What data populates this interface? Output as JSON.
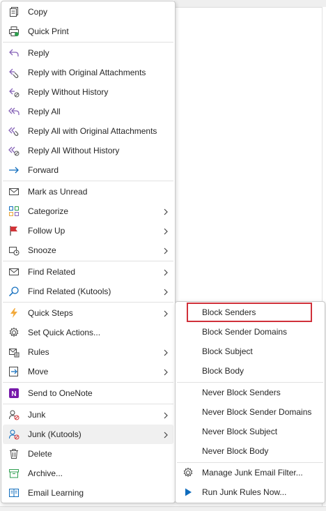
{
  "menu": {
    "items": [
      {
        "label": "Copy",
        "ul": "",
        "icon": "copy-icon"
      },
      {
        "label": "Quick Print",
        "ul": "",
        "icon": "quick-print-icon"
      },
      {
        "label": "Reply",
        "ul": "",
        "icon": "reply-icon"
      },
      {
        "label": "Reply with Original Attachments",
        "icon": "reply-attachments-icon"
      },
      {
        "label": "Reply Without History",
        "icon": "reply-no-history-icon"
      },
      {
        "label": "Reply All",
        "icon": "reply-all-icon"
      },
      {
        "label": "Reply All with Original Attachments",
        "icon": "reply-all-attachments-icon"
      },
      {
        "label": "Reply All Without History",
        "icon": "reply-all-no-history-icon"
      },
      {
        "label": "Forward",
        "icon": "forward-icon"
      },
      {
        "label": "Mark as Unread",
        "icon": "mark-unread-icon"
      },
      {
        "label": "Categorize",
        "icon": "categorize-icon"
      },
      {
        "label": "Follow Up",
        "icon": "follow-up-flag-icon"
      },
      {
        "label": "Snooze",
        "icon": "snooze-icon"
      },
      {
        "label": "Find Related",
        "icon": "find-related-icon"
      },
      {
        "label": "Find Related (Kutools)",
        "icon": "search-icon"
      },
      {
        "label": "Quick Steps",
        "icon": "lightning-icon"
      },
      {
        "label": "Set Quick Actions...",
        "icon": "gear-icon"
      },
      {
        "label": "Rules",
        "icon": "rules-icon"
      },
      {
        "label": "Move",
        "icon": "move-icon"
      },
      {
        "label": "Send to OneNote",
        "icon": "onenote-icon"
      },
      {
        "label": "Junk",
        "icon": "junk-icon"
      },
      {
        "label": "Junk (Kutools)",
        "icon": "junk-kutools-icon"
      },
      {
        "label": "Delete",
        "icon": "delete-icon"
      },
      {
        "label": "Archive...",
        "icon": "archive-icon"
      },
      {
        "label": "Email Learning",
        "icon": "email-learning-icon"
      }
    ]
  },
  "submenu": {
    "items": [
      {
        "label": "Block Senders"
      },
      {
        "label": "Block Sender Domains"
      },
      {
        "label": "Block Subject"
      },
      {
        "label": "Block Body"
      },
      {
        "label": "Never Block Senders"
      },
      {
        "label": "Never Block Sender Domains"
      },
      {
        "label": "Never Block Subject"
      },
      {
        "label": "Never Block Body"
      },
      {
        "label": "Manage Junk Email Filter...",
        "icon": "gear-icon"
      },
      {
        "label": "Run Junk Rules Now...",
        "icon": "play-icon"
      }
    ]
  },
  "colors": {
    "accent": "#0f6cbd",
    "reply_purple": "#8764b8",
    "highlight_border": "#d0303a",
    "hover_bg": "#f0f0f0"
  }
}
